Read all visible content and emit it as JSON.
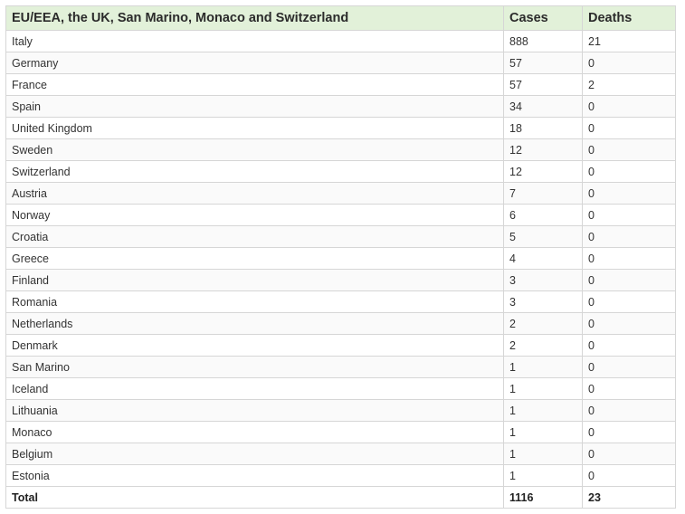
{
  "table": {
    "headers": {
      "region": "EU/EEA, the UK, San Marino, Monaco and Switzerland",
      "cases": "Cases",
      "deaths": "Deaths"
    },
    "rows": [
      {
        "country": "Italy",
        "cases": "888",
        "deaths": "21"
      },
      {
        "country": "Germany",
        "cases": "57",
        "deaths": "0"
      },
      {
        "country": "France",
        "cases": "57",
        "deaths": "2"
      },
      {
        "country": "Spain",
        "cases": "34",
        "deaths": "0"
      },
      {
        "country": "United Kingdom",
        "cases": "18",
        "deaths": "0"
      },
      {
        "country": "Sweden",
        "cases": "12",
        "deaths": "0"
      },
      {
        "country": "Switzerland",
        "cases": "12",
        "deaths": "0"
      },
      {
        "country": "Austria",
        "cases": "7",
        "deaths": "0"
      },
      {
        "country": "Norway",
        "cases": "6",
        "deaths": "0"
      },
      {
        "country": "Croatia",
        "cases": "5",
        "deaths": "0"
      },
      {
        "country": "Greece",
        "cases": "4",
        "deaths": "0"
      },
      {
        "country": "Finland",
        "cases": "3",
        "deaths": "0"
      },
      {
        "country": "Romania",
        "cases": "3",
        "deaths": "0"
      },
      {
        "country": "Netherlands",
        "cases": "2",
        "deaths": "0"
      },
      {
        "country": "Denmark",
        "cases": "2",
        "deaths": "0"
      },
      {
        "country": "San Marino",
        "cases": "1",
        "deaths": "0"
      },
      {
        "country": "Iceland",
        "cases": "1",
        "deaths": "0"
      },
      {
        "country": "Lithuania",
        "cases": "1",
        "deaths": "0"
      },
      {
        "country": "Monaco",
        "cases": "1",
        "deaths": "0"
      },
      {
        "country": "Belgium",
        "cases": "1",
        "deaths": "0"
      },
      {
        "country": "Estonia",
        "cases": "1",
        "deaths": "0"
      }
    ],
    "total": {
      "label": "Total",
      "cases": "1116",
      "deaths": "23"
    }
  },
  "colors": {
    "header_background": "#e2f1d9",
    "border": "#d6d6d6"
  }
}
